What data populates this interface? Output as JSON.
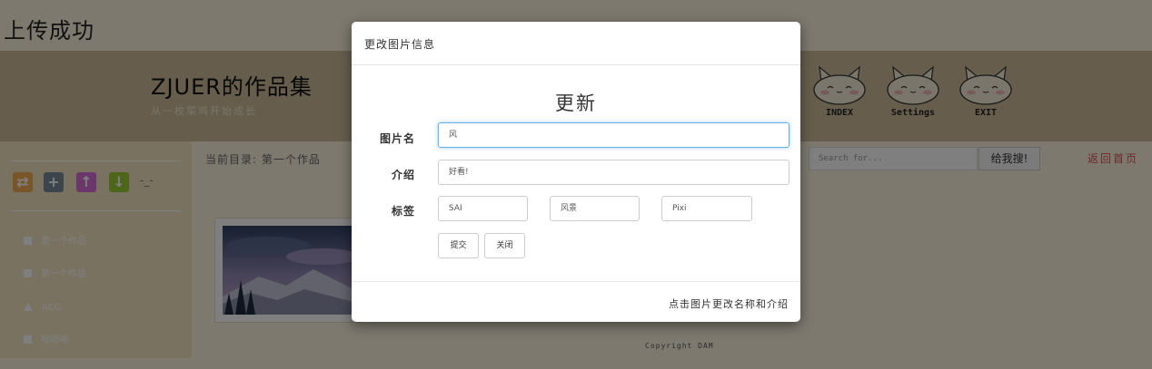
{
  "page": {
    "success_title": "上传成功",
    "copyright": "Copyright DAM"
  },
  "header": {
    "site_title": "ZJUER的作品集",
    "site_subtitle": "从一枚菜鸡开始成长",
    "nav": [
      {
        "label": "INDEX",
        "icon": "bunny-icon"
      },
      {
        "label": "Settings",
        "icon": "bunny-icon"
      },
      {
        "label": "EXIT",
        "icon": "bunny-icon"
      }
    ]
  },
  "sidebar": {
    "tools": [
      {
        "icon": "swap-icon",
        "color": "#f0ad4e"
      },
      {
        "icon": "plus-icon",
        "color": "#7a8b99"
      },
      {
        "icon": "upload-arrow-icon",
        "color": "#d66fd4"
      },
      {
        "icon": "download-arrow-icon",
        "color": "#9acd32"
      }
    ],
    "tool_text": "-_-",
    "items": [
      {
        "label": "第一个作品",
        "icon": "square-bullet-icon"
      },
      {
        "label": "第一个作品",
        "icon": "square-bullet-icon"
      },
      {
        "label": "ACG",
        "icon": "triangle-icon"
      },
      {
        "label": "嗝嗝嗝",
        "icon": "square-bullet-icon"
      }
    ]
  },
  "main": {
    "breadcrumb": "当前目录: 第一个作品"
  },
  "search": {
    "placeholder": "Search for...",
    "button_label": "给我搜!"
  },
  "home_link": "返回首页",
  "modal": {
    "title": "更改图片信息",
    "heading": "更新",
    "name_label": "图片名",
    "name_value": "风",
    "desc_label": "介绍",
    "desc_value": "好看!",
    "tags_label": "标签",
    "tags": [
      "SAI",
      "风景",
      "Pixi"
    ],
    "submit_label": "提交",
    "close_label": "关闭",
    "footer_hint": "点击图片更改名称和介绍"
  },
  "colors": {
    "header_bg": "#cdbb99",
    "page_bg": "#fbf3df",
    "sidebar_bg": "#f3e4c2",
    "home_link": "#d9534f",
    "focus_border": "#66afe9"
  }
}
